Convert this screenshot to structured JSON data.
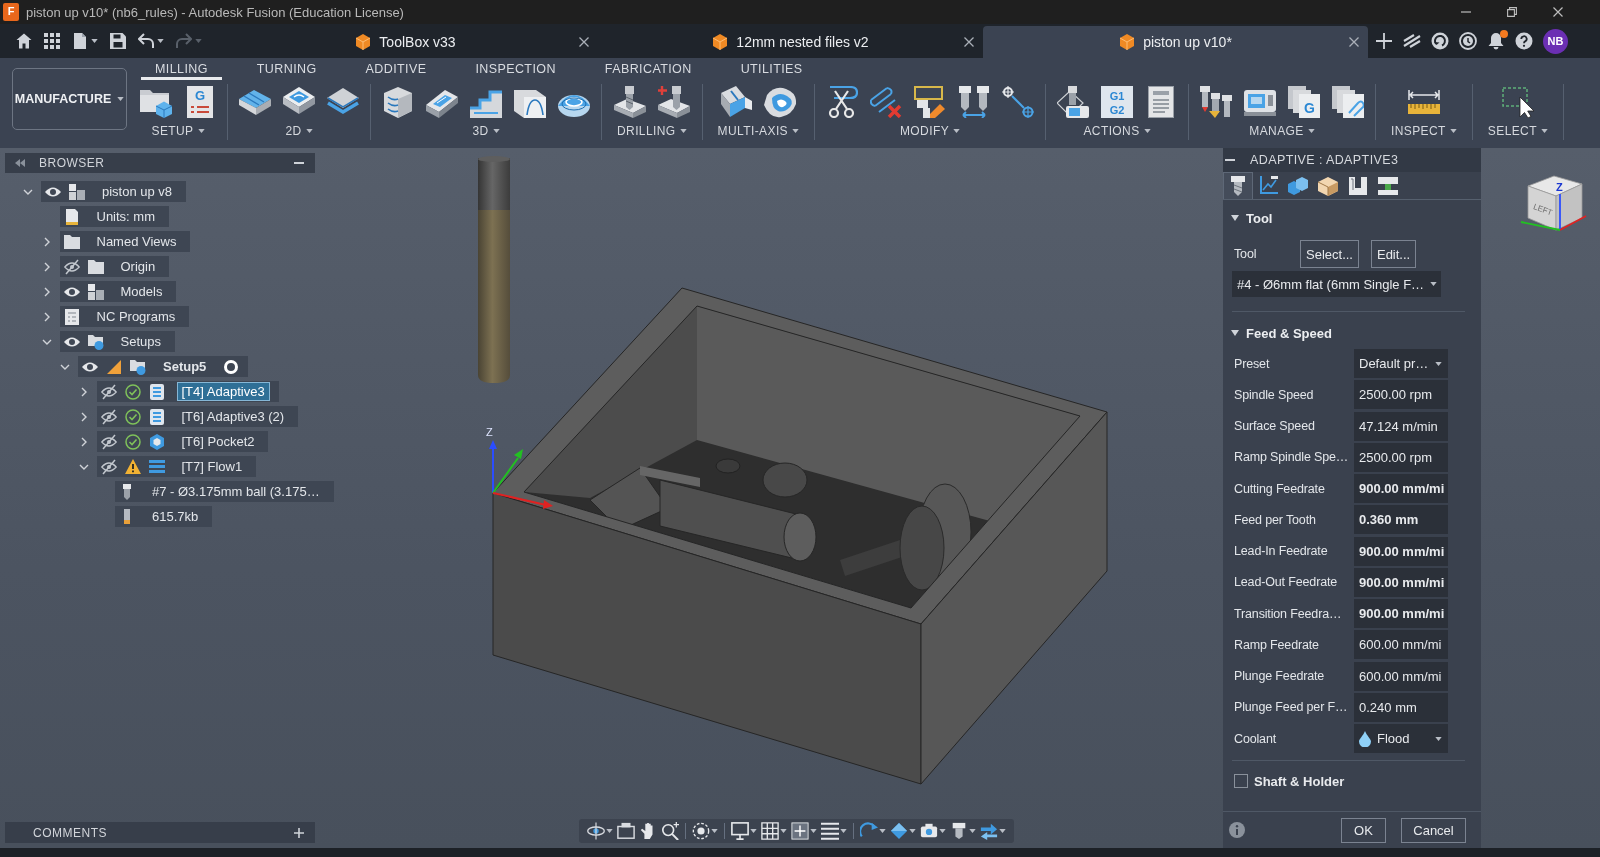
{
  "window": {
    "logo": "F",
    "title": "piston up v10* (nb6_rules) - Autodesk Fusion (Education License)"
  },
  "quick_access": [
    {
      "kind": "home",
      "disabled": false
    },
    {
      "kind": "apps",
      "disabled": false
    },
    {
      "kind": "file",
      "disabled": false
    },
    {
      "kind": "save",
      "disabled": false
    },
    {
      "kind": "undo",
      "disabled": false
    },
    {
      "kind": "redo",
      "disabled": true
    }
  ],
  "document_tabs": [
    {
      "label": "ToolBox v33",
      "selected": false
    },
    {
      "label": "12mm nested files v2",
      "selected": false
    },
    {
      "label": "piston up v10*",
      "selected": true
    }
  ],
  "notifications": {
    "unread": true
  },
  "account": {
    "initials": "NB"
  },
  "workspace": {
    "label": "MANUFACTURE"
  },
  "ribbon_tabs": [
    {
      "label": "MILLING",
      "selected": true
    },
    {
      "label": "TURNING",
      "selected": false
    },
    {
      "label": "ADDITIVE",
      "selected": false
    },
    {
      "label": "INSPECTION",
      "selected": false
    },
    {
      "label": "FABRICATION",
      "selected": false
    },
    {
      "label": "UTILITIES",
      "selected": false
    }
  ],
  "ribbon_groups": [
    {
      "label": "SETUP",
      "tools": [
        {
          "kind": "setup"
        },
        {
          "kind": "nc-program",
          "glyphs": [
            "G"
          ]
        }
      ]
    },
    {
      "label": "2D",
      "tools": [
        {
          "kind": "face"
        },
        {
          "kind": "adaptive-2d"
        },
        {
          "kind": "pocket-2d"
        }
      ]
    },
    {
      "label": "3D",
      "tools": [
        {
          "kind": "adaptive-3d"
        },
        {
          "kind": "pocket-3d"
        },
        {
          "kind": "steep"
        },
        {
          "kind": "scallop"
        },
        {
          "kind": "dome"
        }
      ]
    },
    {
      "label": "DRILLING",
      "tools": [
        {
          "kind": "drill"
        },
        {
          "kind": "hole"
        }
      ]
    },
    {
      "label": "MULTI-AXIS",
      "tools": [
        {
          "kind": "swarf"
        },
        {
          "kind": "multi"
        }
      ]
    },
    {
      "label": "MODIFY",
      "tools": [
        {
          "kind": "cut"
        },
        {
          "kind": "delete"
        },
        {
          "kind": "edit"
        },
        {
          "kind": "compare"
        },
        {
          "kind": "path"
        }
      ]
    },
    {
      "label": "ACTIONS",
      "tools": [
        {
          "kind": "simulate"
        },
        {
          "kind": "post",
          "glyphs": [
            "G1",
            "G2"
          ]
        },
        {
          "kind": "sheet"
        }
      ]
    },
    {
      "label": "MANAGE",
      "tools": [
        {
          "kind": "library"
        },
        {
          "kind": "machine"
        },
        {
          "kind": "templates",
          "glyphs": [
            "G"
          ]
        },
        {
          "kind": "documents"
        }
      ]
    },
    {
      "label": "INSPECT",
      "tools": [
        {
          "kind": "measure"
        }
      ]
    },
    {
      "label": "SELECT",
      "tools": [
        {
          "kind": "select"
        }
      ]
    }
  ],
  "browser": {
    "title": "BROWSER",
    "tree": [
      {
        "label": "piston up v8",
        "kind": "component",
        "expanded": true,
        "visible": true,
        "selected": false,
        "children": [
          {
            "label": "Units: mm",
            "kind": "units",
            "selected": false
          },
          {
            "label": "Named Views",
            "kind": "folder",
            "expanded": false,
            "selected": false
          },
          {
            "label": "Origin",
            "kind": "folder",
            "expanded": false,
            "visible": false,
            "selected": false
          },
          {
            "label": "Models",
            "kind": "component",
            "expanded": false,
            "visible": true,
            "selected": false
          },
          {
            "label": "NC Programs",
            "kind": "nc",
            "expanded": false,
            "selected": false
          },
          {
            "label": "Setups",
            "kind": "setups",
            "expanded": true,
            "visible": true,
            "selected": false,
            "children": [
              {
                "label": "Setup5",
                "kind": "setup",
                "expanded": true,
                "visible": true,
                "active": true,
                "selected": false,
                "children": [
                  {
                    "label": "[T4] Adaptive3",
                    "kind": "adaptive",
                    "expanded": false,
                    "visible": false,
                    "warning": false,
                    "selected": true
                  },
                  {
                    "label": "[T6] Adaptive3 (2)",
                    "kind": "adaptive",
                    "expanded": false,
                    "visible": false,
                    "warning": false,
                    "selected": false
                  },
                  {
                    "label": "[T6] Pocket2",
                    "kind": "pocket",
                    "expanded": false,
                    "visible": false,
                    "warning": false,
                    "selected": false
                  },
                  {
                    "label": "[T7] Flow1",
                    "kind": "flow",
                    "expanded": true,
                    "visible": false,
                    "warning": true,
                    "selected": false,
                    "children": [
                      {
                        "label": "#7 - Ø3.175mm ball (3.175…",
                        "kind": "tool",
                        "selected": false
                      },
                      {
                        "label": "615.7kb",
                        "kind": "file",
                        "selected": false
                      }
                    ]
                  }
                ]
              }
            ]
          }
        ]
      }
    ]
  },
  "comments": {
    "title": "COMMENTS"
  },
  "viewport": {
    "axis_label": "Z",
    "view_cube": {
      "face": "LEFT",
      "axis": "Z"
    }
  },
  "operation_panel": {
    "title": "ADAPTIVE : ADAPTIVE3",
    "tabs": [
      {
        "kind": "tool",
        "selected": true
      },
      {
        "kind": "geometry",
        "selected": false
      },
      {
        "kind": "heights",
        "selected": false
      },
      {
        "kind": "passes",
        "selected": false
      },
      {
        "kind": "linking",
        "selected": false
      },
      {
        "kind": "axis",
        "selected": false
      }
    ],
    "sections": [
      {
        "title": "Tool",
        "expanded": true,
        "rows": [
          {
            "kind": "buttons",
            "label": "Tool",
            "buttons": [
              "Select...",
              "Edit..."
            ]
          },
          {
            "kind": "dropdown",
            "value": "#4 - Ø6mm flat (6mm Single F…"
          }
        ]
      },
      {
        "title": "Feed & Speed",
        "expanded": true,
        "rows": [
          {
            "kind": "dropdown",
            "label": "Preset",
            "value": "Default pr…"
          },
          {
            "kind": "field",
            "label": "Spindle Speed",
            "value": "2500.00 rpm",
            "modified": false
          },
          {
            "kind": "field",
            "label": "Surface Speed",
            "value": "47.124 m/min",
            "modified": false
          },
          {
            "kind": "field",
            "label": "Ramp Spindle Spe…",
            "value": "2500.00 rpm",
            "modified": false
          },
          {
            "kind": "field",
            "label": "Cutting Feedrate",
            "value": "900.00 mm/mi",
            "modified": true
          },
          {
            "kind": "field",
            "label": "Feed per Tooth",
            "value": "0.360 mm",
            "modified": true
          },
          {
            "kind": "field",
            "label": "Lead-In Feedrate",
            "value": "900.00 mm/mi",
            "modified": true
          },
          {
            "kind": "field",
            "label": "Lead-Out Feedrate",
            "value": "900.00 mm/mi",
            "modified": true
          },
          {
            "kind": "field",
            "label": "Transition Feedra…",
            "value": "900.00 mm/mi",
            "modified": true
          },
          {
            "kind": "field",
            "label": "Ramp Feedrate",
            "value": "600.00 mm/mi",
            "modified": false
          },
          {
            "kind": "field",
            "label": "Plunge Feedrate",
            "value": "600.00 mm/mi",
            "modified": false
          },
          {
            "kind": "field",
            "label": "Plunge Feed per F…",
            "value": "0.240 mm",
            "modified": false
          },
          {
            "kind": "coolant",
            "label": "Coolant",
            "value": "Flood"
          }
        ]
      }
    ],
    "options": [
      {
        "label": "Shaft & Holder",
        "checked": false
      }
    ],
    "buttons": [
      "OK",
      "Cancel"
    ]
  }
}
